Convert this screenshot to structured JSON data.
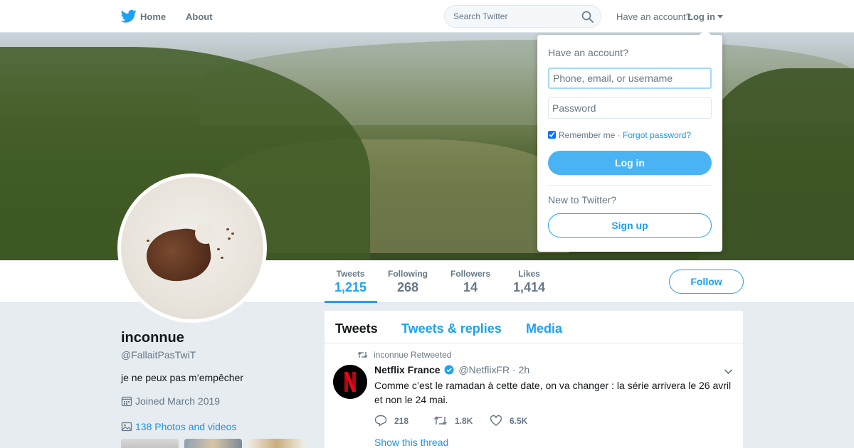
{
  "nav": {
    "logo_icon": "twitter-bird-icon",
    "home_label": "Home",
    "about_label": "About",
    "search_placeholder": "Search Twitter",
    "have_account_text": "Have an account?",
    "login_label": "Log in"
  },
  "profile": {
    "name": "inconnue",
    "handle": "@FallaitPasTwiT",
    "bio": "je ne peux pas m’empêcher",
    "joined": "Joined March 2019",
    "photos_link": "138 Photos and videos"
  },
  "stats": [
    {
      "label": "Tweets",
      "value": "1,215",
      "active": true
    },
    {
      "label": "Following",
      "value": "268"
    },
    {
      "label": "Followers",
      "value": "14"
    },
    {
      "label": "Likes",
      "value": "1,414"
    }
  ],
  "follow_label": "Follow",
  "timeline": {
    "tabs": [
      "Tweets",
      "Tweets & replies",
      "Media"
    ],
    "active_tab": "Tweets",
    "tweet": {
      "retweet_note": "inconnue Retweeted",
      "author": "Netflix France",
      "handle": "@NetflixFR",
      "time": "· 2h",
      "text": "Comme c’est le ramadan à cette date, on va changer : la série arrivera le 26 avril et non le 24 mai.",
      "replies": "218",
      "retweets": "1.8K",
      "likes": "6.5K",
      "show_thread": "Show this thread"
    }
  },
  "login_dropdown": {
    "heading": "Have an account?",
    "username_placeholder": "Phone, email, or username",
    "password_placeholder": "Password",
    "remember_me": "Remember me",
    "separator": "·",
    "forgot_password": "Forgot password?",
    "login_button": "Log in",
    "new_prompt": "New to Twitter?",
    "signup_button": "Sign up"
  },
  "colors": {
    "brand_blue": "#1da1f2",
    "login_button_blue": "#4ab3f4",
    "link_blue": "#1b95e0",
    "page_bg": "#e6ecf0",
    "text_gray": "#657786"
  }
}
